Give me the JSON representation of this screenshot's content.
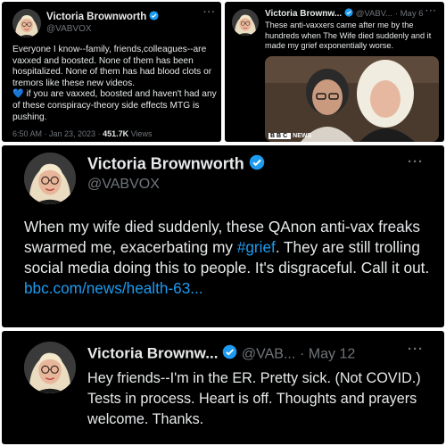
{
  "tweets": [
    {
      "name": "Victoria Brownworth",
      "handle": "@VABVOX",
      "more_icon": "more-horizontal-icon",
      "verified_icon": "verified-badge-icon",
      "text_line1": "Everyone I know--family, friends,colleagues--are vaxxed and boosted. None of them has been hospitalized. None of them has had blood clots or tremors like these new videos.",
      "heart_icon": "blue-heart-icon",
      "text_line2": " if you are vaxxed, boosted and haven't had any of these conspiracy-theory side effects MTG is pushing.",
      "time": "6:50 AM · Jan 23, 2023 · ",
      "views_count": "451.7K",
      "views_label": " Views"
    },
    {
      "name": "Victoria Brownw...",
      "handle": "@VABV...",
      "date": "· May 6",
      "text": "These anti-vaxxers came after me by the hundreds when The Wife died suddenly and it made my grief exponentially worse.",
      "image_logo": "BBC",
      "image_caption": "NEWS"
    },
    {
      "name": "Victoria Brownworth",
      "handle": "@VABVOX",
      "text_before": "When my wife died suddenly, these QAnon anti-vax freaks swarmed me, exacerbating my ",
      "hashtag": "#grief",
      "text_after": ". They are still trolling social media doing this to people. It's disgraceful. Call it out.",
      "link": "bbc.com/news/health-63..."
    },
    {
      "name": "Victoria Brownw...",
      "handle": "@VAB...",
      "date": "· May 12",
      "text": "Hey friends--I'm in the ER.  Pretty sick. (Not COVID.) Tests in process. Heart is off. Thoughts and prayers welcome. Thanks."
    }
  ],
  "colors": {
    "background": "#000000",
    "text": "#e7e9ea",
    "muted": "#71767b",
    "link": "#1d9bf0",
    "verified": "#1d9bf0"
  }
}
